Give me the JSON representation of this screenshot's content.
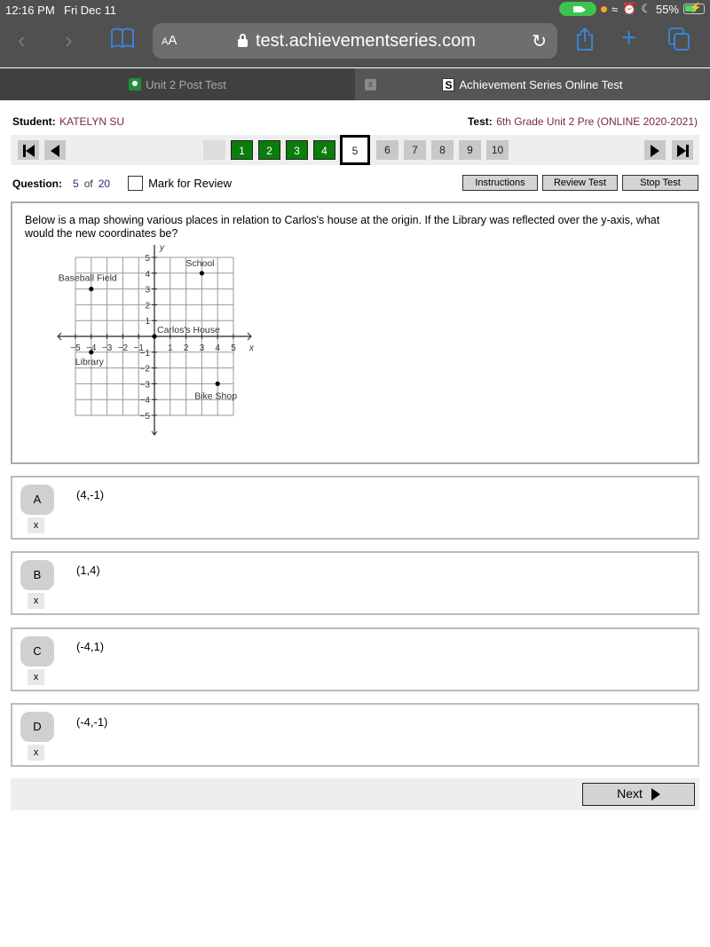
{
  "status_bar": {
    "time": "12:16 PM",
    "date": "Fri Dec 11",
    "battery": "55%"
  },
  "browser": {
    "text_size_label": "AA",
    "url": "test.achievementseries.com",
    "tabs": [
      {
        "label": "Unit 2 Post Test",
        "icon": "google-classroom-icon",
        "active": false
      },
      {
        "label": "Achievement Series Online Test",
        "icon": "achievement-series-icon",
        "active": true
      }
    ],
    "tab_close_label": "x"
  },
  "header": {
    "student_label": "Student:",
    "student_name": "KATELYN SU",
    "test_label": "Test:",
    "test_name": "6th Grade Unit 2 Pre (ONLINE 2020-2021)"
  },
  "question_nav": {
    "numbers": [
      "1",
      "2",
      "3",
      "4",
      "5",
      "6",
      "7",
      "8",
      "9",
      "10"
    ],
    "answered": [
      "1",
      "2",
      "3",
      "4"
    ],
    "current": "5"
  },
  "question_info": {
    "label": "Question:",
    "current": "5",
    "of": "of",
    "total": "20",
    "mark_for_review": "Mark for Review",
    "mark_for_review_checked": false
  },
  "toolbar": {
    "instructions": "Instructions",
    "review_test": "Review Test",
    "stop_test": "Stop Test"
  },
  "question": {
    "text": "Below is a map showing various places in relation to Carlos's house at the origin. If the Library was reflected over the y-axis, what would the new coordinates be?",
    "graph": {
      "x_label": "x",
      "y_label": "y",
      "x_range": [
        -5,
        5
      ],
      "y_range": [
        -5,
        5
      ],
      "x_ticks": [
        "-5",
        "-4",
        "-3",
        "-2",
        "-1",
        "1",
        "2",
        "3",
        "4",
        "5"
      ],
      "y_ticks": [
        "5",
        "4",
        "3",
        "2",
        "1",
        "-1",
        "-2",
        "-3",
        "-4",
        "-5"
      ],
      "points": [
        {
          "label": "Baseball Field",
          "x": -4,
          "y": 3
        },
        {
          "label": "School",
          "x": 3,
          "y": 4
        },
        {
          "label": "Carlos's House",
          "x": 0,
          "y": 0
        },
        {
          "label": "Library",
          "x": -4,
          "y": -1
        },
        {
          "label": "Bike Shop",
          "x": 4,
          "y": -3
        }
      ]
    }
  },
  "choices": [
    {
      "letter": "A",
      "text": "(4,-1)",
      "eliminate": "x"
    },
    {
      "letter": "B",
      "text": "(1,4)",
      "eliminate": "x"
    },
    {
      "letter": "C",
      "text": "(-4,1)",
      "eliminate": "x"
    },
    {
      "letter": "D",
      "text": "(-4,-1)",
      "eliminate": "x"
    }
  ],
  "footer": {
    "next_label": "Next"
  }
}
